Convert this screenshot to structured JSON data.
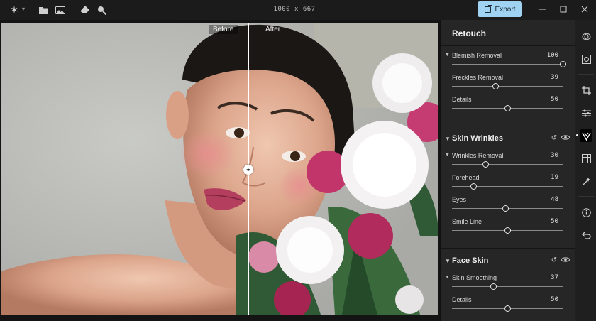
{
  "toolbar": {
    "icons": [
      "sparkle-logo-icon",
      "folder-icon",
      "image-icon",
      "eraser-icon",
      "magnify-icon"
    ],
    "dimensions": "1000 x 667",
    "export_label": "Export"
  },
  "window": {
    "controls": [
      "minimize",
      "maximize",
      "close"
    ]
  },
  "compare": {
    "before_label": "Before",
    "after_label": "After"
  },
  "panel": {
    "title": "Retouch",
    "top_sliders": [
      {
        "label": "Blemish Removal",
        "value": "100",
        "fraction": 1.0,
        "has_caret": true
      },
      {
        "label": "Freckles Removal",
        "value": "39",
        "fraction": 0.39,
        "has_caret": false
      },
      {
        "label": "Details",
        "value": "50",
        "fraction": 0.5,
        "has_caret": false
      }
    ],
    "skin_wrinkles": {
      "title": "Skin Wrinkles",
      "sliders": [
        {
          "label": "Wrinkles Removal",
          "value": "30",
          "fraction": 0.3,
          "has_caret": true
        },
        {
          "label": "Forehead",
          "value": "19",
          "fraction": 0.19,
          "has_caret": false
        },
        {
          "label": "Eyes",
          "value": "48",
          "fraction": 0.48,
          "has_caret": false
        },
        {
          "label": "Smile Line",
          "value": "50",
          "fraction": 0.5,
          "has_caret": false
        }
      ]
    },
    "face_skin": {
      "title": "Face Skin",
      "sliders": [
        {
          "label": "Skin Smoothing",
          "value": "37",
          "fraction": 0.37,
          "has_caret": true
        },
        {
          "label": "Details",
          "value": "50",
          "fraction": 0.5,
          "has_caret": false
        }
      ]
    }
  },
  "right_tools": [
    "overlap-circles-icon",
    "face-frame-icon",
    "crop-icon",
    "adjust-sliders-icon",
    "retouch-icon",
    "texture-icon",
    "magic-wand-icon",
    "info-icon",
    "undo-icon"
  ],
  "colors": {
    "accent": "#9fd3f1",
    "panel": "#262627",
    "background": "#1b1b1c"
  }
}
